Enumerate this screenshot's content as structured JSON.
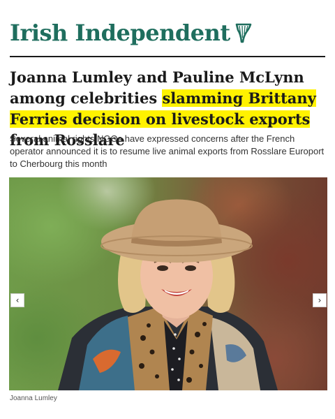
{
  "masthead": {
    "brand": "Irish Independent",
    "logo_icon": "harp-icon",
    "brand_color": "#1f6e5e"
  },
  "article": {
    "headline_part1": "Joanna Lumley and Pauline McLynn among celebrities ",
    "headline_highlight": "slamming Brittany Ferries decision on livestock exports",
    "headline_part2": " from Rosslare",
    "highlight_color": "#fff200",
    "standfirst": "Several animal rights NGOs have expressed concerns after the French operator announced it is to resume live animal exports from Rosslare Europort to Cherbourg this month"
  },
  "gallery": {
    "prev_icon": "‹",
    "next_icon": "›",
    "caption": "Joanna Lumley"
  }
}
